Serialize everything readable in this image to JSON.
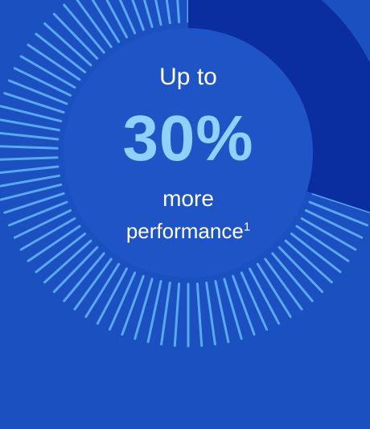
{
  "stat": {
    "prefix": "Up to",
    "value": "30%",
    "suffix_line1": "more",
    "suffix_line2": "performance",
    "footnote": "1",
    "progress_fraction": 0.3
  },
  "colors": {
    "background": "#1b50c0",
    "inner_disc": "#1e54c6",
    "highlight_sector": "#0a2ea0",
    "tick_marks": "#5aa8f0",
    "value_text": "#8fd0ff",
    "label_text": "#ffffff"
  }
}
